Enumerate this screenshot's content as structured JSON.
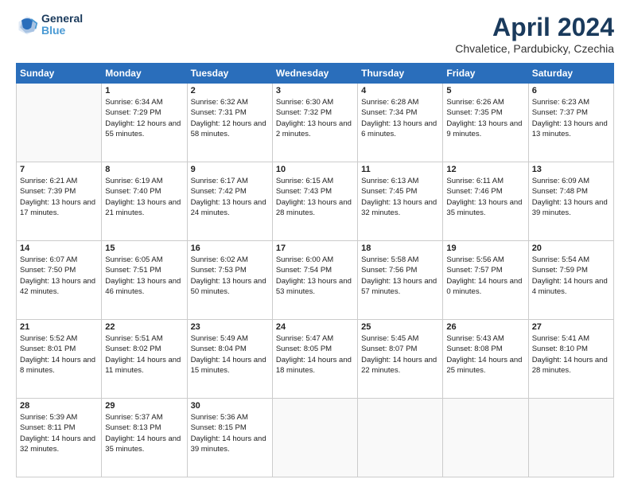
{
  "logo": {
    "line1": "General",
    "line2": "Blue"
  },
  "title": "April 2024",
  "subtitle": "Chvaletice, Pardubicky, Czechia",
  "weekdays": [
    "Sunday",
    "Monday",
    "Tuesday",
    "Wednesday",
    "Thursday",
    "Friday",
    "Saturday"
  ],
  "weeks": [
    [
      {
        "day": null
      },
      {
        "day": 1,
        "sunrise": "Sunrise: 6:34 AM",
        "sunset": "Sunset: 7:29 PM",
        "daylight": "Daylight: 12 hours and 55 minutes."
      },
      {
        "day": 2,
        "sunrise": "Sunrise: 6:32 AM",
        "sunset": "Sunset: 7:31 PM",
        "daylight": "Daylight: 12 hours and 58 minutes."
      },
      {
        "day": 3,
        "sunrise": "Sunrise: 6:30 AM",
        "sunset": "Sunset: 7:32 PM",
        "daylight": "Daylight: 13 hours and 2 minutes."
      },
      {
        "day": 4,
        "sunrise": "Sunrise: 6:28 AM",
        "sunset": "Sunset: 7:34 PM",
        "daylight": "Daylight: 13 hours and 6 minutes."
      },
      {
        "day": 5,
        "sunrise": "Sunrise: 6:26 AM",
        "sunset": "Sunset: 7:35 PM",
        "daylight": "Daylight: 13 hours and 9 minutes."
      },
      {
        "day": 6,
        "sunrise": "Sunrise: 6:23 AM",
        "sunset": "Sunset: 7:37 PM",
        "daylight": "Daylight: 13 hours and 13 minutes."
      }
    ],
    [
      {
        "day": 7,
        "sunrise": "Sunrise: 6:21 AM",
        "sunset": "Sunset: 7:39 PM",
        "daylight": "Daylight: 13 hours and 17 minutes."
      },
      {
        "day": 8,
        "sunrise": "Sunrise: 6:19 AM",
        "sunset": "Sunset: 7:40 PM",
        "daylight": "Daylight: 13 hours and 21 minutes."
      },
      {
        "day": 9,
        "sunrise": "Sunrise: 6:17 AM",
        "sunset": "Sunset: 7:42 PM",
        "daylight": "Daylight: 13 hours and 24 minutes."
      },
      {
        "day": 10,
        "sunrise": "Sunrise: 6:15 AM",
        "sunset": "Sunset: 7:43 PM",
        "daylight": "Daylight: 13 hours and 28 minutes."
      },
      {
        "day": 11,
        "sunrise": "Sunrise: 6:13 AM",
        "sunset": "Sunset: 7:45 PM",
        "daylight": "Daylight: 13 hours and 32 minutes."
      },
      {
        "day": 12,
        "sunrise": "Sunrise: 6:11 AM",
        "sunset": "Sunset: 7:46 PM",
        "daylight": "Daylight: 13 hours and 35 minutes."
      },
      {
        "day": 13,
        "sunrise": "Sunrise: 6:09 AM",
        "sunset": "Sunset: 7:48 PM",
        "daylight": "Daylight: 13 hours and 39 minutes."
      }
    ],
    [
      {
        "day": 14,
        "sunrise": "Sunrise: 6:07 AM",
        "sunset": "Sunset: 7:50 PM",
        "daylight": "Daylight: 13 hours and 42 minutes."
      },
      {
        "day": 15,
        "sunrise": "Sunrise: 6:05 AM",
        "sunset": "Sunset: 7:51 PM",
        "daylight": "Daylight: 13 hours and 46 minutes."
      },
      {
        "day": 16,
        "sunrise": "Sunrise: 6:02 AM",
        "sunset": "Sunset: 7:53 PM",
        "daylight": "Daylight: 13 hours and 50 minutes."
      },
      {
        "day": 17,
        "sunrise": "Sunrise: 6:00 AM",
        "sunset": "Sunset: 7:54 PM",
        "daylight": "Daylight: 13 hours and 53 minutes."
      },
      {
        "day": 18,
        "sunrise": "Sunrise: 5:58 AM",
        "sunset": "Sunset: 7:56 PM",
        "daylight": "Daylight: 13 hours and 57 minutes."
      },
      {
        "day": 19,
        "sunrise": "Sunrise: 5:56 AM",
        "sunset": "Sunset: 7:57 PM",
        "daylight": "Daylight: 14 hours and 0 minutes."
      },
      {
        "day": 20,
        "sunrise": "Sunrise: 5:54 AM",
        "sunset": "Sunset: 7:59 PM",
        "daylight": "Daylight: 14 hours and 4 minutes."
      }
    ],
    [
      {
        "day": 21,
        "sunrise": "Sunrise: 5:52 AM",
        "sunset": "Sunset: 8:01 PM",
        "daylight": "Daylight: 14 hours and 8 minutes."
      },
      {
        "day": 22,
        "sunrise": "Sunrise: 5:51 AM",
        "sunset": "Sunset: 8:02 PM",
        "daylight": "Daylight: 14 hours and 11 minutes."
      },
      {
        "day": 23,
        "sunrise": "Sunrise: 5:49 AM",
        "sunset": "Sunset: 8:04 PM",
        "daylight": "Daylight: 14 hours and 15 minutes."
      },
      {
        "day": 24,
        "sunrise": "Sunrise: 5:47 AM",
        "sunset": "Sunset: 8:05 PM",
        "daylight": "Daylight: 14 hours and 18 minutes."
      },
      {
        "day": 25,
        "sunrise": "Sunrise: 5:45 AM",
        "sunset": "Sunset: 8:07 PM",
        "daylight": "Daylight: 14 hours and 22 minutes."
      },
      {
        "day": 26,
        "sunrise": "Sunrise: 5:43 AM",
        "sunset": "Sunset: 8:08 PM",
        "daylight": "Daylight: 14 hours and 25 minutes."
      },
      {
        "day": 27,
        "sunrise": "Sunrise: 5:41 AM",
        "sunset": "Sunset: 8:10 PM",
        "daylight": "Daylight: 14 hours and 28 minutes."
      }
    ],
    [
      {
        "day": 28,
        "sunrise": "Sunrise: 5:39 AM",
        "sunset": "Sunset: 8:11 PM",
        "daylight": "Daylight: 14 hours and 32 minutes."
      },
      {
        "day": 29,
        "sunrise": "Sunrise: 5:37 AM",
        "sunset": "Sunset: 8:13 PM",
        "daylight": "Daylight: 14 hours and 35 minutes."
      },
      {
        "day": 30,
        "sunrise": "Sunrise: 5:36 AM",
        "sunset": "Sunset: 8:15 PM",
        "daylight": "Daylight: 14 hours and 39 minutes."
      },
      {
        "day": null
      },
      {
        "day": null
      },
      {
        "day": null
      },
      {
        "day": null
      }
    ]
  ]
}
